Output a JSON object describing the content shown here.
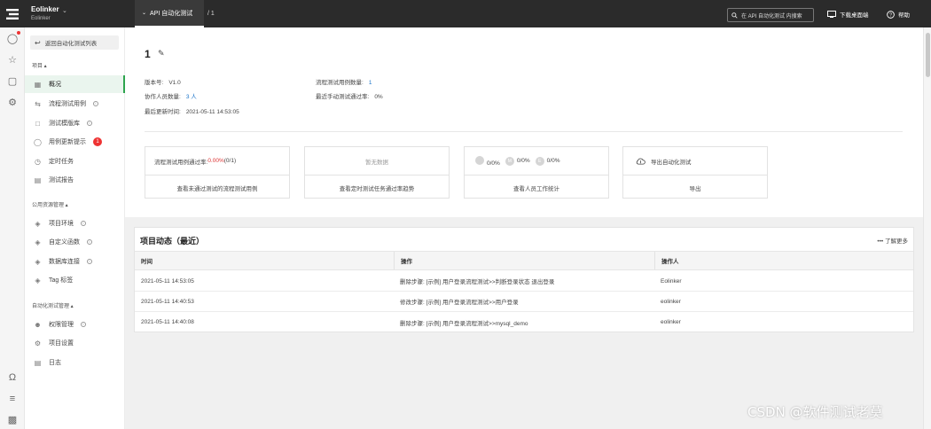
{
  "topbar": {
    "brand_name": "Eolinker",
    "brand_sub": "Eolinker",
    "nav_tab": "API 自动化测试",
    "crumb": "/ 1",
    "search_placeholder": "在 API 自动化测试 内搜索",
    "download_label": "下载桌面端",
    "help_label": "帮助"
  },
  "sidebar": {
    "back_label": "返回自动化测试列表",
    "section_project": "项目 ▴",
    "section_public": "公用资源管理 ▴",
    "section_auto": "自动化测试管理 ▴",
    "items": [
      {
        "label": "概况"
      },
      {
        "label": "流程测试用例"
      },
      {
        "label": "测试模版库"
      },
      {
        "label": "用例更新提示",
        "badge": "1"
      },
      {
        "label": "定时任务"
      },
      {
        "label": "测试报告"
      },
      {
        "label": "项目环境"
      },
      {
        "label": "自定义函数"
      },
      {
        "label": "数据库连接"
      },
      {
        "label": "Tag 标签"
      },
      {
        "label": "权限管理"
      },
      {
        "label": "项目设置"
      },
      {
        "label": "日志"
      }
    ]
  },
  "project": {
    "title": "1",
    "version_label": "版本号:",
    "version_value": "V1.0",
    "collab_label": "协作人员数量:",
    "collab_value": "3 人",
    "updated_label": "最后更新时间:",
    "updated_value": "2021-05-11 14:53:05",
    "case_count_label": "流程测试用例数量:",
    "case_count_value": "1",
    "pass_rate_label": "最近手动测试通过率:",
    "pass_rate_value": "0%"
  },
  "cards": [
    {
      "top_prefix": "流程测试用例通过率: ",
      "top_rate": "0.00%",
      "top_suffix": " (0/1)",
      "bottom": "查看未通过测试的流程测试用例"
    },
    {
      "top": "暂无数据",
      "bottom": "查看定时测试任务通过率趋势"
    },
    {
      "stats": [
        {
          "icon": "",
          "value": "0/0%"
        },
        {
          "icon": "M",
          "value": "0/0%"
        },
        {
          "icon": "E",
          "value": "0/0%"
        }
      ],
      "bottom": "查看人员工作统计"
    },
    {
      "top": "导出自动化测试",
      "bottom": "导出"
    }
  ],
  "activity": {
    "title": "项目动态（最近）",
    "more": "••• 了解更多",
    "columns": [
      "时间",
      "操作",
      "操作人"
    ],
    "rows": [
      [
        "2021-05-11 14:53:05",
        "删除步骤: [示例] 用户登录流程测试>>判断登录状态 退出登录",
        "Eolinker"
      ],
      [
        "2021-05-11 14:40:53",
        "修改步骤: [示例] 用户登录流程测试>>用户登录",
        "eolinker"
      ],
      [
        "2021-05-11 14:40:08",
        "删除步骤: [示例] 用户登录流程测试>>mysql_demo",
        "eolinker"
      ]
    ]
  },
  "watermark": "CSDN @软件测试老莫"
}
